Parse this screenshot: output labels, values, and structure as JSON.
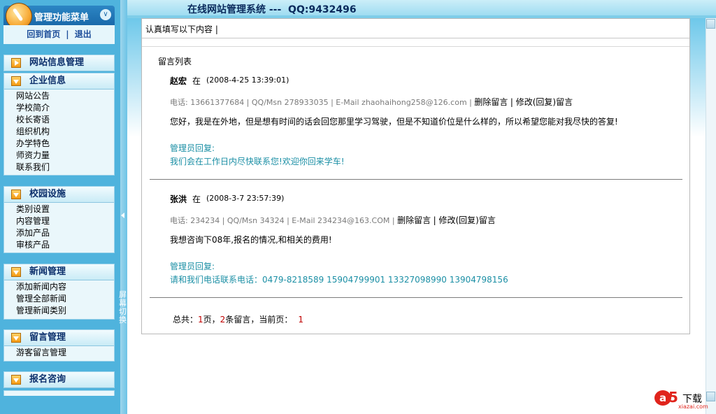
{
  "sidebar": {
    "menu_title": "管理功能菜单",
    "home_link": "回到首页",
    "logout_link": "退出",
    "separator": "|",
    "switch_label": "屏幕切换",
    "panels": [
      {
        "title": "网站信息管理",
        "items": []
      },
      {
        "title": "企业信息",
        "items": [
          "网站公告",
          "学校简介",
          "校长寄语",
          "组织机构",
          "办学特色",
          "师资力量",
          "联系我们"
        ]
      },
      {
        "title": "校园设施",
        "items": [
          "类别设置",
          "内容管理",
          "添加产品",
          "审核产品"
        ]
      },
      {
        "title": "新闻管理",
        "items": [
          "添加新闻内容",
          "管理全部新闻",
          "管理新闻类别"
        ]
      },
      {
        "title": "留言管理",
        "items": [
          "游客留言管理"
        ]
      },
      {
        "title": "报名咨询",
        "items": []
      }
    ]
  },
  "header": {
    "title": "在线网站管理系统 ---  QQ:9432496"
  },
  "content": {
    "instruction": "认真填写以下内容 |",
    "list_title": "留言列表",
    "messages": [
      {
        "name": "赵宏",
        "time_prefix": "在",
        "time": "(2008-4-25 13:39:01)",
        "contact": "电话: 13661377684 | QQ/Msn 278933035 | E-Mail zhaohaihong258@126.com |",
        "delete": "删除留言",
        "edit": "| 修改(回复)留言",
        "body": "您好，我是在外地，但是想有时间的话会回您那里学习驾驶，但是不知道价位是什么样的，所以希望您能对我尽快的答复!",
        "reply_label": "管理员回复:",
        "reply": "我们会在工作日内尽快联系您!欢迎你回来学车!"
      },
      {
        "name": "张洪",
        "time_prefix": "在",
        "time": "(2008-3-7 23:57:39)",
        "contact": "电话: 234234 | QQ/Msn 34324 | E-Mail 234234@163.COM |",
        "delete": "删除留言",
        "edit": "| 修改(回复)留言",
        "body": "我想咨询下08年,报名的情况,和相关的费用!",
        "reply_label": "管理员回复:",
        "reply": "请和我们电话联系电话：0479-8218589 15904799901 13327098990 13904798156"
      }
    ],
    "pager": {
      "total_prefix": "总共：",
      "pages": "1",
      "pages_suffix": "页，",
      "count": "2",
      "count_suffix": "条留言，当前页：",
      "current": "1"
    }
  },
  "watermark": {
    "logo_a": "a",
    "logo_5": "5",
    "text": "下载",
    "sub": "xiazai.com"
  },
  "colors": {
    "sidebar_bg": "#4fb3dd",
    "reply": "#1b8fa5",
    "pager_num": "#c00000"
  }
}
